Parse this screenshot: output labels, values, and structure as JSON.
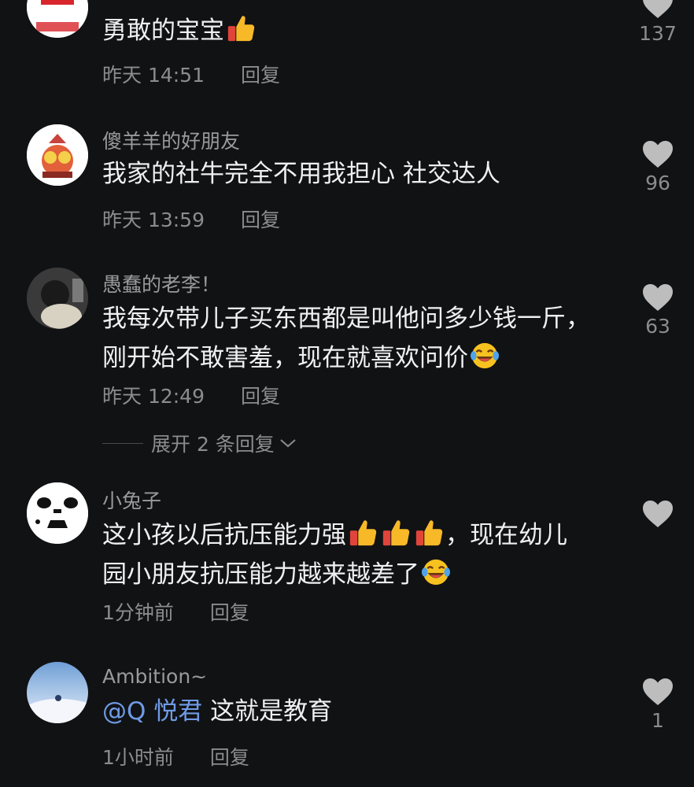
{
  "comments": [
    {
      "username": "",
      "text": "勇敢的宝宝",
      "emojis": [
        "thumbs-up"
      ],
      "time": "昨天 14:51",
      "reply_label": "回复",
      "likes": "137"
    },
    {
      "username": "傻羊羊的好朋友",
      "text": "我家的社牛完全不用我担心 社交达人",
      "time": "昨天 13:59",
      "reply_label": "回复",
      "likes": "96"
    },
    {
      "username": "愚蠢的老李！",
      "text_line1": "我每次带儿子买东西都是叫他问多少钱一斤，",
      "text_line2": "刚开始不敢害羞，现在就喜欢问价",
      "emojis": [
        "laughing-crying"
      ],
      "time": "昨天 12:49",
      "reply_label": "回复",
      "likes": "63"
    },
    {
      "username": "小兔子",
      "text_line1a": "这小孩以后抗压能力强",
      "text_line1b": "，现在幼儿",
      "text_line2": "园小朋友抗压能力越来越差了",
      "emojis": [
        "thumbs-up",
        "thumbs-up",
        "thumbs-up",
        "laughing-crying"
      ],
      "time": "1分钟前",
      "reply_label": "回复",
      "likes": ""
    },
    {
      "username": "Ambition~",
      "mention": "@Q 悦君",
      "text": "这就是教育",
      "time": "1小时前",
      "reply_label": "回复",
      "likes": "1"
    }
  ],
  "expand_replies": {
    "label": "展开 2 条回复"
  },
  "colors": {
    "background": "#111214",
    "text": "#f0f0f0",
    "meta": "#8c8c8c",
    "mention": "#6f9be6",
    "heart": "#bdbdbd"
  },
  "icons": [
    "heart-icon",
    "thumbs-up-emoji",
    "laughing-crying-emoji",
    "chevron-down-icon"
  ]
}
